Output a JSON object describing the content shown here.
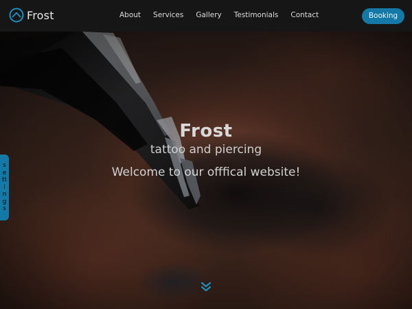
{
  "brand": {
    "name": "Frost",
    "icon": "house-outline-icon",
    "icon_color": "#1e8fc0"
  },
  "nav": {
    "links": [
      {
        "label": "About"
      },
      {
        "label": "Services"
      },
      {
        "label": "Gallery"
      },
      {
        "label": "Testimonials"
      },
      {
        "label": "Contact"
      }
    ],
    "booking_label": "Booking"
  },
  "hero": {
    "title": "Frost",
    "subtitle": "tattoo and piercing",
    "welcome": "Welcome to our offfical website!",
    "scroll_icon": "double-chevron-down-icon"
  },
  "settings_tab": {
    "label": "settings"
  },
  "colors": {
    "accent": "#1479a6",
    "navbar_bg": "#161616"
  }
}
